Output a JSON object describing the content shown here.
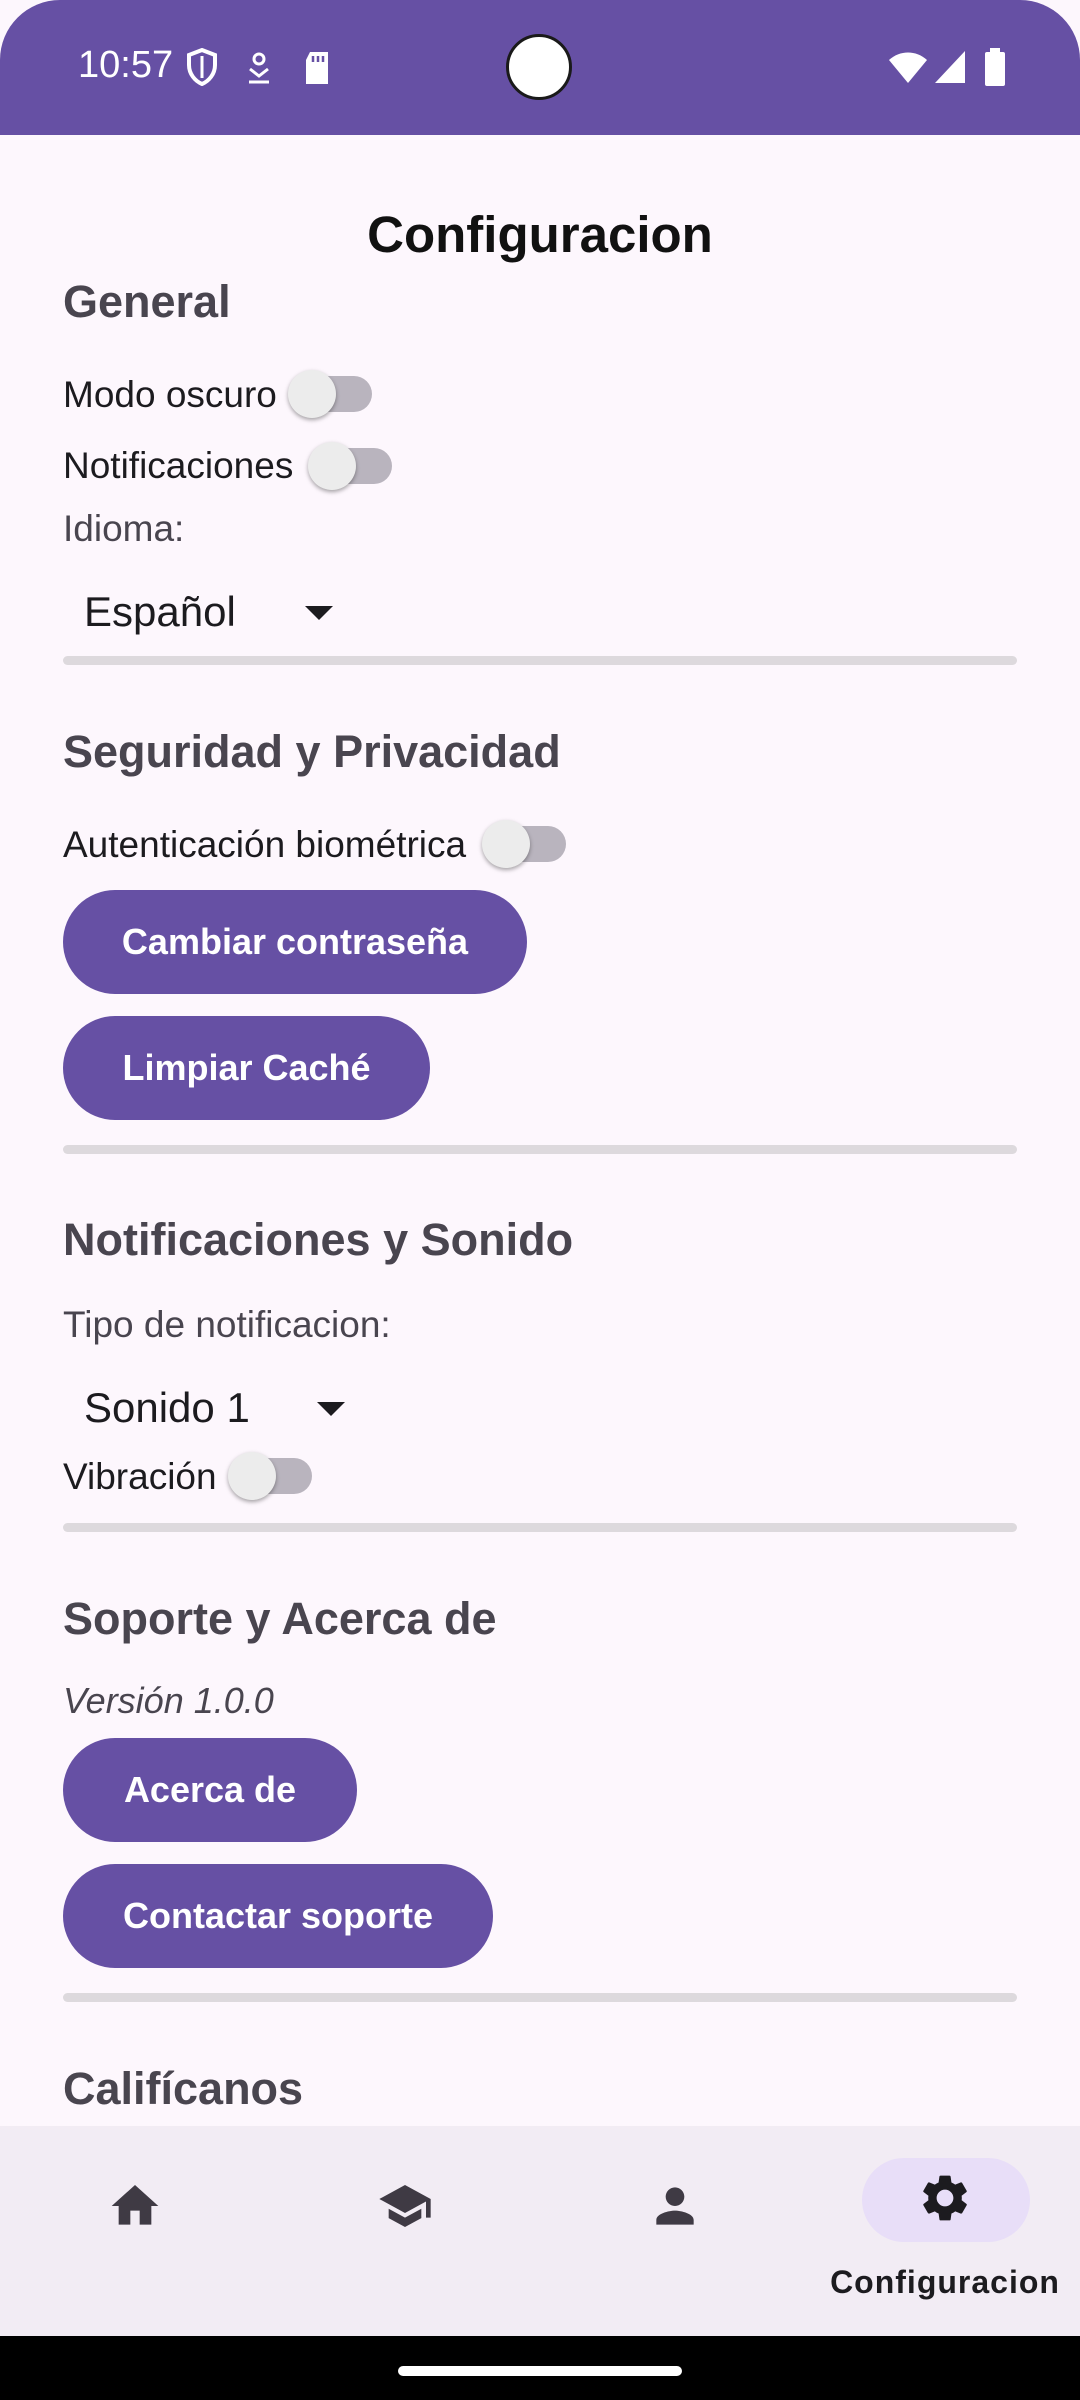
{
  "status_bar": {
    "time": "10:57"
  },
  "page_title": "Configuracion",
  "general": {
    "heading": "General",
    "dark_mode_label": "Modo oscuro",
    "notifications_label": "Notificaciones",
    "language_label": "Idioma:",
    "language_value": "Español"
  },
  "security": {
    "heading": "Seguridad y Privacidad",
    "biometric_label": "Autenticación biométrica",
    "change_password_label": "Cambiar contraseña",
    "clear_cache_label": "Limpiar Caché"
  },
  "sound": {
    "heading": "Notificaciones y Sonido",
    "notification_type_label": "Tipo de notificacion:",
    "notification_type_value": "Sonido 1",
    "vibration_label": "Vibración"
  },
  "support": {
    "heading": "Soporte y Acerca de",
    "version": "Versión 1.0.0",
    "about_label": "Acerca de",
    "contact_label": "Contactar soporte"
  },
  "rate": {
    "heading": "Califícanos"
  },
  "toggles": {
    "dark_mode": false,
    "notifications": false,
    "biometric": false,
    "vibration": false
  },
  "bottom_nav": {
    "items": [
      {
        "icon": "home-icon"
      },
      {
        "icon": "school-icon"
      },
      {
        "icon": "person-icon"
      },
      {
        "icon": "settings-icon",
        "label": "Configuracion",
        "selected": true
      }
    ]
  },
  "colors": {
    "primary": "#6650A4",
    "background": "#FDF7FD",
    "nav_background": "#F2ECF4",
    "nav_indicator": "#E8DEF8"
  }
}
